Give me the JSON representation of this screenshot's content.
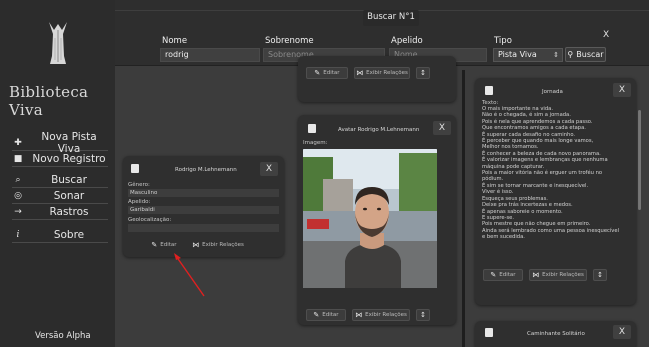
{
  "sidebar": {
    "brand": "Biblioteca Viva",
    "items": [
      {
        "label": "Nova Pista Viva",
        "icon": "add-note-icon",
        "glyph": "✚"
      },
      {
        "label": "Novo Registro",
        "icon": "new-record-icon",
        "glyph": "■"
      },
      {
        "label": "Buscar",
        "icon": "search-icon",
        "glyph": "⌕"
      },
      {
        "label": "Sonar",
        "icon": "sonar-icon",
        "glyph": "◎"
      },
      {
        "label": "Rastros",
        "icon": "tracks-icon",
        "glyph": "→"
      },
      {
        "label": "Sobre",
        "icon": "info-icon",
        "glyph": "i"
      }
    ],
    "version": "Versão Alpha"
  },
  "search": {
    "title": "Buscar N°1",
    "close": "X",
    "fields": {
      "nome": {
        "label": "Nome",
        "value": "rodrig"
      },
      "sobrenome": {
        "label": "Sobrenome",
        "placeholder": "Sobrenome"
      },
      "apelido": {
        "label": "Apelido",
        "placeholder": "Nome"
      },
      "tipo": {
        "label": "Tipo",
        "value": "Pista Viva"
      }
    },
    "button": "Buscar"
  },
  "cards": {
    "top_partial": {
      "edit": "Editar",
      "relations": "Exibir Relações"
    },
    "person": {
      "title": "Rodrigo M.Lehnemann",
      "close": "X",
      "fields": [
        {
          "label": "Gênero:",
          "value": "Masculino"
        },
        {
          "label": "Apelido:",
          "value": "Garibaldi"
        },
        {
          "label": "Geolocalização:",
          "value": ""
        }
      ],
      "edit": "Editar",
      "relations": "Exibir Relações"
    },
    "avatar": {
      "title": "Avatar Rodrigo M.Lehnemann",
      "close": "X",
      "image_label": "Imagem:",
      "edit": "Editar",
      "relations": "Exibir Relações"
    },
    "jornada": {
      "title": "Jornada",
      "close": "X",
      "text_label": "Texto:",
      "text": "O mais importante na vida.\nNão é o chegada, é sim a jornada.\nPois é nela que aprendemos a cada passo.\nQue encontramos amigos a cada etapa.\nÉ superar cada desafio no caminho.\nÉ perceber que quando mais longe vamos,\nMelhor nos tornamos.\nÉ conhecer a beleza de cada novo panorama.\nÉ valorizar imagens e lembranças que nenhuma\nmáquina pode capturar.\nPois a maior vitória não é erguer um troféu no\npódium.\nÉ sim se tornar marcante e inesquecível.\nViver é isso.\nEsqueça seus problemas.\nDeixe pra trás incertezas e medos.\nÉ apenas saboreie o momento.\nE supere-se.\nPois mestre que não chegue em primeiro.\nAinda será lembrado como uma pessoa inesquecível\ne bem sucedida.",
      "edit": "Editar",
      "relations": "Exibir Relações"
    },
    "caminhante": {
      "title": "Caminhante Solitário",
      "close": "X"
    }
  },
  "colors": {
    "sidebar_bg": "#2c2c2c",
    "content_bg": "#3c3c3c",
    "card_bg": "#2f2f2f",
    "annotation_arrow": "#e02020"
  }
}
